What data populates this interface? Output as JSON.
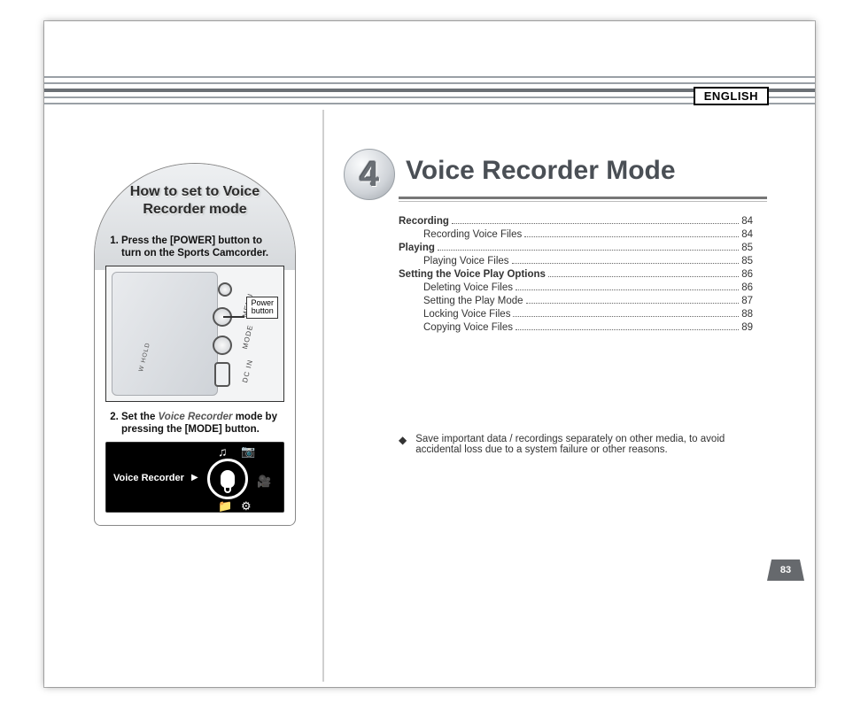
{
  "language_tag": "ENGLISH",
  "chapter": {
    "number": "4",
    "title": "Voice Recorder Mode"
  },
  "toc": [
    {
      "title": "Recording",
      "page": "84",
      "bold": true,
      "sub": false
    },
    {
      "title": "Recording Voice Files",
      "page": "84",
      "bold": false,
      "sub": true
    },
    {
      "title": "Playing",
      "page": "85",
      "bold": true,
      "sub": false
    },
    {
      "title": "Playing Voice Files",
      "page": "85",
      "bold": false,
      "sub": true
    },
    {
      "title": "Setting the Voice Play Options",
      "page": "86",
      "bold": true,
      "sub": false
    },
    {
      "title": "Deleting Voice Files",
      "page": "86",
      "bold": false,
      "sub": true
    },
    {
      "title": "Setting the Play Mode",
      "page": "87",
      "bold": false,
      "sub": true
    },
    {
      "title": "Locking Voice Files",
      "page": "88",
      "bold": false,
      "sub": true
    },
    {
      "title": "Copying Voice Files",
      "page": "89",
      "bold": false,
      "sub": true
    }
  ],
  "note": "Save important data / recordings separately on other media, to avoid accidental loss due to a system failure or other reasons.",
  "page_number": "83",
  "callout": {
    "heading": "How to set to Voice Recorder mode",
    "step1": "Press the [POWER] button to turn on the Sports Camcorder.",
    "step2_pre": "Set the ",
    "step2_em": "Voice Recorder",
    "step2_post": " mode by pressing the [MODE] button.",
    "power_label_l1": "Power",
    "power_label_l2": "button",
    "device_labels": {
      "menu": "MENU",
      "mode": "MODE",
      "dcin": "DC IN",
      "hold": "W HOLD"
    },
    "mode_selector_label": "Voice Recorder",
    "mode_arrow": "▶",
    "icons": {
      "music": "♫",
      "camera": "📷",
      "video": "🎥",
      "folder": "📁",
      "gear": "⚙"
    }
  }
}
